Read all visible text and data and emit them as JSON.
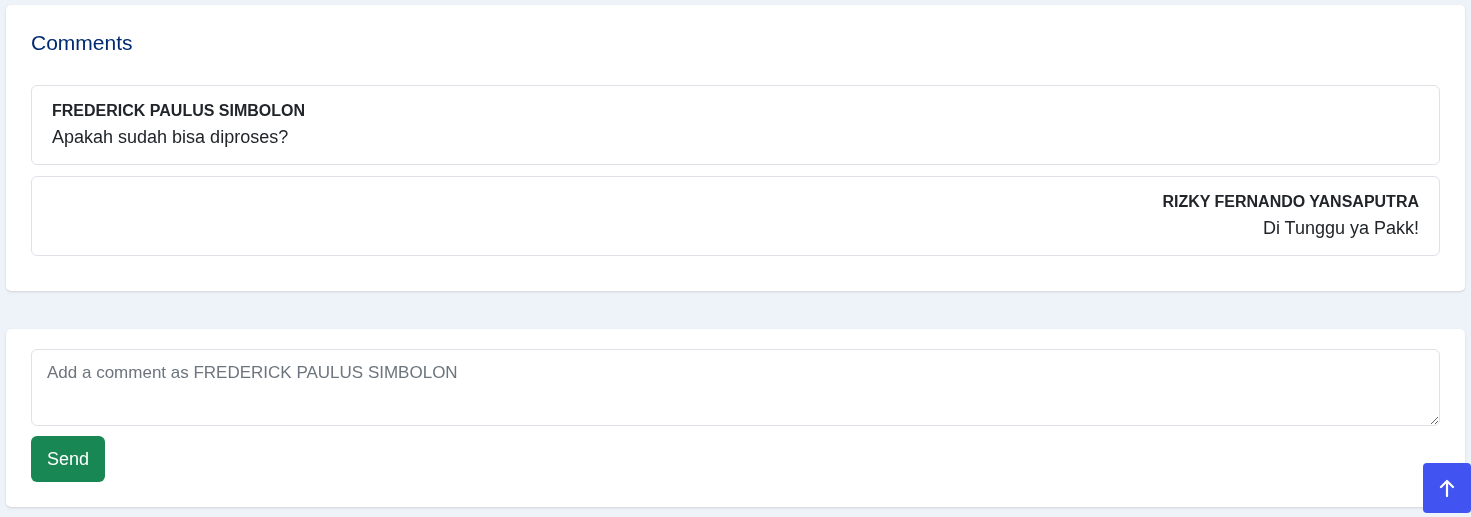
{
  "comments_card": {
    "title": "Comments",
    "comments": [
      {
        "kind": "other",
        "author": "FREDERICK PAULUS SIMBOLON",
        "text": "Apakah sudah bisa diproses?"
      },
      {
        "kind": "own",
        "author": "RIZKY FERNANDO YANSAPUTRA",
        "text": "Di Tunggu ya Pakk!"
      }
    ]
  },
  "compose": {
    "placeholder": "Add a comment as FREDERICK PAULUS SIMBOLON",
    "send_button": "Send"
  }
}
